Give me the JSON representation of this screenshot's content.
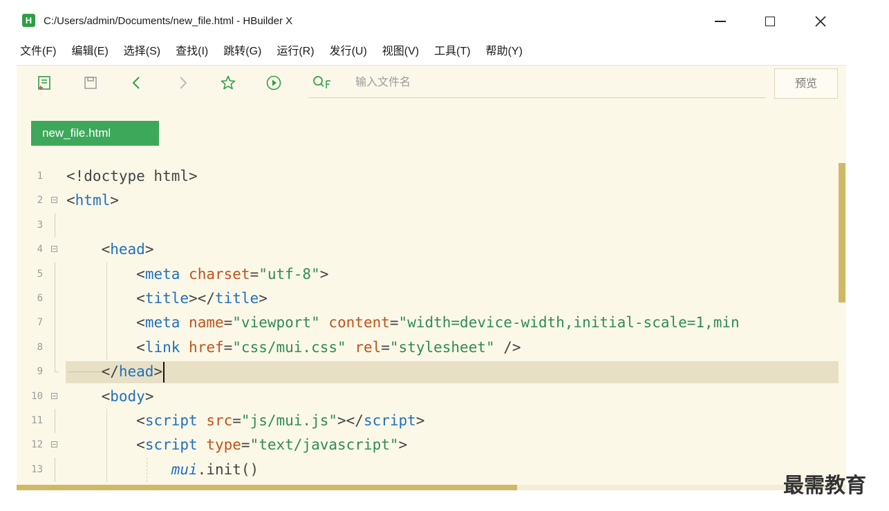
{
  "window": {
    "title": "C:/Users/admin/Documents/new_file.html - HBuilder X",
    "app_icon_letter": "H"
  },
  "menu": [
    {
      "label": "文件(F)"
    },
    {
      "label": "编辑(E)"
    },
    {
      "label": "选择(S)"
    },
    {
      "label": "查找(I)"
    },
    {
      "label": "跳转(G)"
    },
    {
      "label": "运行(R)"
    },
    {
      "label": "发行(U)"
    },
    {
      "label": "视图(V)"
    },
    {
      "label": "工具(T)"
    },
    {
      "label": "帮助(Y)"
    }
  ],
  "toolbar": {
    "search_placeholder": "输入文件名",
    "preview_label": "预览"
  },
  "editor": {
    "active_tab": "new_file.html",
    "current_line": 9,
    "line_numbers": [
      "1",
      "2",
      "3",
      "4",
      "5",
      "6",
      "7",
      "8",
      "9",
      "10",
      "11",
      "12",
      "13"
    ]
  },
  "watermark": "最需教育",
  "colors": {
    "tab_active": "#3da85a",
    "editor_bg": "#fcf8e8",
    "scrollbar": "#d1b866",
    "tag": "#1f6fbf",
    "attribute": "#c0511a",
    "string": "#2e8b57"
  }
}
